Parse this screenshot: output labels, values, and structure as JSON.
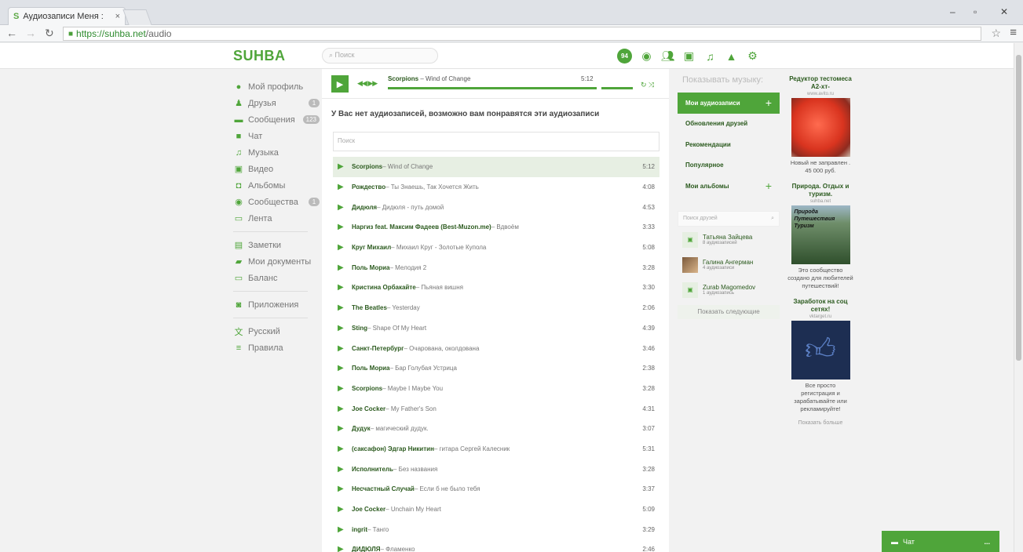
{
  "browser": {
    "tab_title": "Аудиозаписи Меня :",
    "tab_close": "×",
    "favicon": "S",
    "url_host": "https://suhba.net",
    "url_path": "/audio",
    "controls": {
      "minimize": "–",
      "restore": "▫",
      "close": "✕"
    }
  },
  "header": {
    "logo": "SUHBA",
    "search_placeholder": "Поиск",
    "notif_count": "94"
  },
  "leftmenu": {
    "items": [
      {
        "label": "Мой профиль",
        "icon": "user-icon"
      },
      {
        "label": "Друзья",
        "icon": "friends-icon",
        "count": "1"
      },
      {
        "label": "Сообщения",
        "icon": "messages-icon",
        "count": "123"
      },
      {
        "label": "Чат",
        "icon": "chat-icon"
      },
      {
        "label": "Музыка",
        "icon": "music-icon"
      },
      {
        "label": "Видео",
        "icon": "video-icon"
      },
      {
        "label": "Альбомы",
        "icon": "camera-icon"
      },
      {
        "label": "Сообщества",
        "icon": "communities-icon",
        "count": "1"
      },
      {
        "label": "Лента",
        "icon": "feed-icon"
      }
    ],
    "items2": [
      {
        "label": "Заметки",
        "icon": "notes-icon"
      },
      {
        "label": "Мои документы",
        "icon": "documents-icon"
      },
      {
        "label": "Баланс",
        "icon": "balance-icon"
      }
    ],
    "apps": "Приложения",
    "language": "Русский",
    "rules": "Правила"
  },
  "player": {
    "artist": "Scorpions",
    "song": " – Wind of Change",
    "time": "5:12",
    "progress": 1.0
  },
  "notice": "У Вас нет аудиозаписей, возможно вам понравятся эти аудиозаписи",
  "track_search_placeholder": "Поиск",
  "tracks": [
    {
      "artist": "Scorpions",
      "song": " – Wind of Change",
      "duration": "5:12"
    },
    {
      "artist": "Рождество",
      "song": " – Ты Знаешь, Так Хочется Жить",
      "duration": "4:08"
    },
    {
      "artist": "Дидюля",
      "song": " – Дидюля - путь домой",
      "duration": "4:53"
    },
    {
      "artist": "Наргиз feat. Максим Фадеев (Best-Muzon.me)",
      "song": " – Вдвоём",
      "duration": "3:33"
    },
    {
      "artist": "Круг Михаил",
      "song": " – Михаил Круг - Золотые Купола",
      "duration": "5:08"
    },
    {
      "artist": "Поль Мориа",
      "song": " – Мелодия 2",
      "duration": "3:28"
    },
    {
      "artist": "Кристина Орбакайте",
      "song": " – Пьяная вишня",
      "duration": "3:30"
    },
    {
      "artist": "The Beatles",
      "song": " – Yesterday",
      "duration": "2:06"
    },
    {
      "artist": "Sting",
      "song": " – Shape Of My Heart",
      "duration": "4:39"
    },
    {
      "artist": "Санкт-Петербург",
      "song": " – Очарована, околдована",
      "duration": "3:46"
    },
    {
      "artist": "Поль Мориа",
      "song": " – Бар Голубая Устрица",
      "duration": "2:38"
    },
    {
      "artist": "Scorpions",
      "song": " – Maybe I Maybe You",
      "duration": "3:28"
    },
    {
      "artist": "Joe Cocker",
      "song": " – My Father's Son",
      "duration": "4:31"
    },
    {
      "artist": "Дудук",
      "song": " – магический дудук.",
      "duration": "3:07"
    },
    {
      "artist": "(саксафон) Эдгар Никитин",
      "song": " – гитара Сергей Калесник",
      "duration": "5:31"
    },
    {
      "artist": "Исполнитель",
      "song": " – Без названия",
      "duration": "3:28"
    },
    {
      "artist": "Несчастный Случай",
      "song": " – Если б не было тебя",
      "duration": "3:37"
    },
    {
      "artist": "Joe Cocker",
      "song": " – Unchain My Heart",
      "duration": "5:09"
    },
    {
      "artist": "ingrit",
      "song": " – Танго",
      "duration": "3:29"
    },
    {
      "artist": "ДИДЮЛЯ",
      "song": " – Фламенко",
      "duration": "2:46"
    }
  ],
  "music_panel": {
    "title": "Показывать музыку:",
    "items": [
      "Мои аудиозаписи",
      "Обновления друзей",
      "Рекомендации",
      "Популярное",
      "Мои альбомы"
    ],
    "friend_search": "Поиск друзей",
    "friends": [
      {
        "name": "Татьяна Зайцева",
        "sub": "8 аудиозаписей"
      },
      {
        "name": "Галина Ангерман",
        "sub": "4 аудиозаписи"
      },
      {
        "name": "Zurab Magomedov",
        "sub": "1 аудиозапись"
      }
    ],
    "show_next": "Показать следующие"
  },
  "ads": [
    {
      "title": "Редуктор тестомеса А2-хт-",
      "url": "www.avito.ru",
      "text": "Новый не заправлен . 45 000 руб."
    },
    {
      "title": "Природа. Отдых и туризм.",
      "url": "suhba.net",
      "text": "Это сообщество создано для любителей путешествий!",
      "image_text": "Природа Путешествия Туризм"
    },
    {
      "title": "Заработок на соц сетях!",
      "url": "vktarget.ru",
      "text": "Все просто регистрация и зарабатывайте или рекламируйте!"
    }
  ],
  "ads_more": "Показать больше",
  "chat": {
    "label": "Чат",
    "dots": "..."
  }
}
